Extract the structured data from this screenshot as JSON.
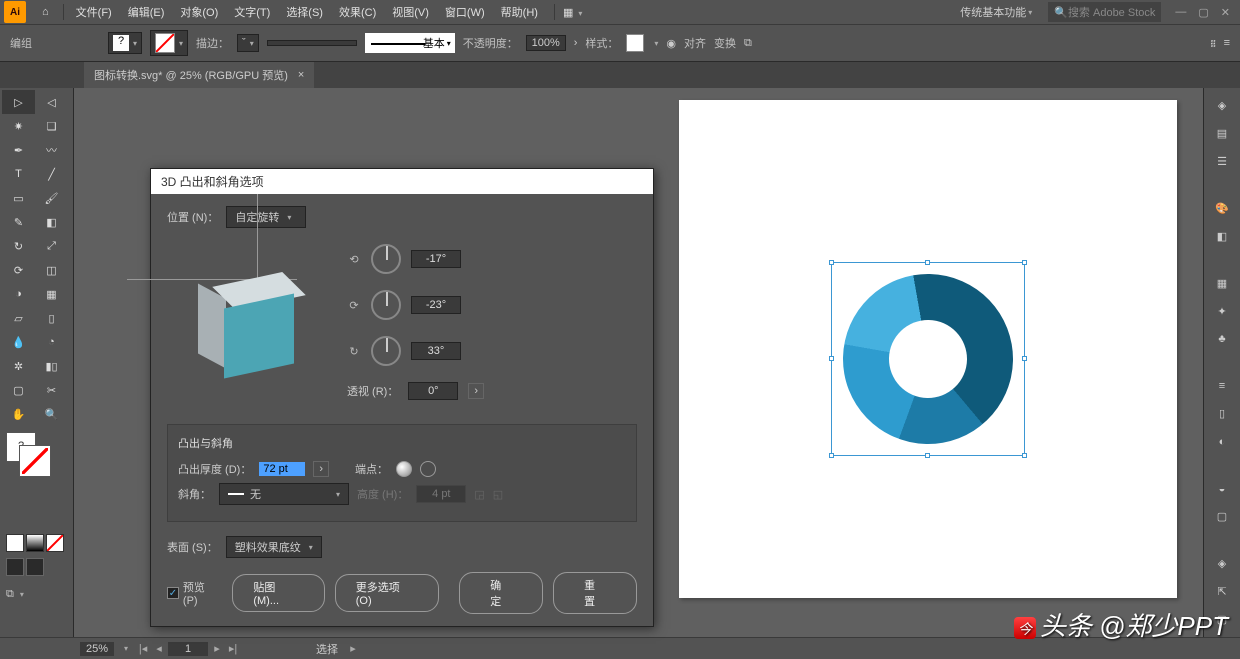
{
  "menu": {
    "items": [
      "文件(F)",
      "编辑(E)",
      "对象(O)",
      "文字(T)",
      "选择(S)",
      "效果(C)",
      "视图(V)",
      "窗口(W)",
      "帮助(H)"
    ],
    "workspace_label": "传统基本功能",
    "search_placeholder": "搜索 Adobe Stock"
  },
  "options": {
    "group_label": "编组",
    "stroke_label": "描边：",
    "stroke_caret": "ˇ",
    "brush_label": "基本",
    "opacity_label": "不透明度：",
    "opacity_value": "100%",
    "style_label": "样式：",
    "align_label": "对齐",
    "transform_label": "变换"
  },
  "tab": {
    "title": "图标转换.svg* @ 25% (RGB/GPU 预览)"
  },
  "dialog": {
    "title": "3D 凸出和斜角选项",
    "position_label": "位置 (N)：",
    "position_value": "自定旋转",
    "rot_x": "-17°",
    "rot_y": "-23°",
    "rot_z": "33°",
    "perspective_label": "透视 (R)：",
    "perspective_value": "0°",
    "extrude_header": "凸出与斜角",
    "depth_label": "凸出厚度 (D)：",
    "depth_value": "72 pt",
    "cap_label": "端点：",
    "bevel_label": "斜角：",
    "bevel_value": "无",
    "height_label": "高度 (H)：",
    "height_value": "4 pt",
    "surface_label": "表面 (S)：",
    "surface_value": "塑料效果底纹",
    "preview_label": "预览 (P)",
    "map_btn": "贴图 (M)...",
    "more_btn": "更多选项 (O)",
    "ok_btn": "确定",
    "reset_btn": "重置"
  },
  "status": {
    "zoom": "25%",
    "page": "1",
    "select_label": "选择"
  },
  "watermark": "头条 @郑少PPT"
}
